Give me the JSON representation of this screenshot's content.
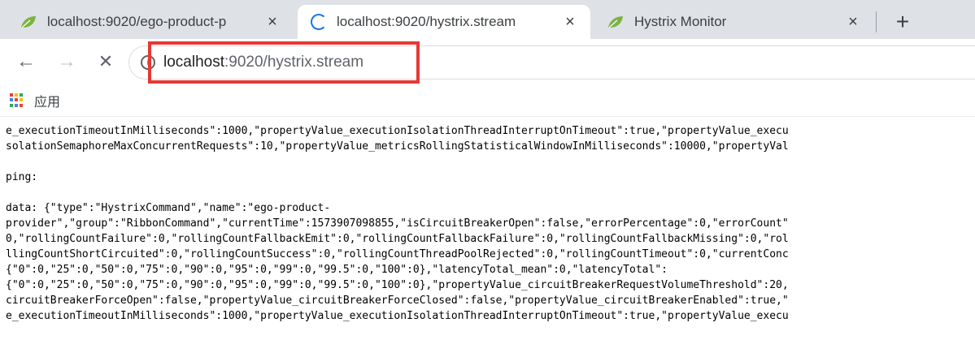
{
  "tabs": [
    {
      "title": "localhost:9020/ego-product-p",
      "close": "×",
      "icon": "leaf-icon",
      "active": false
    },
    {
      "title": "localhost:9020/hystrix.stream",
      "close": "×",
      "icon": "loading-spinner-icon",
      "active": true
    },
    {
      "title": "Hystrix Monitor",
      "close": "×",
      "icon": "leaf-icon",
      "active": false
    }
  ],
  "new_tab_label": "+",
  "toolbar": {
    "back": "←",
    "forward": "→",
    "stop": "✕",
    "url_host": "localhost",
    "url_rest": ":9020/hystrix.stream"
  },
  "bookmarks": {
    "apps_label": "应用"
  },
  "colors": {
    "tab_strip": "#dee1e6",
    "highlight": "#e53935",
    "leaf": "#7cb342"
  },
  "content": {
    "lines_a": [
      "e_executionTimeoutInMilliseconds\":1000,\"propertyValue_executionIsolationThreadInterruptOnTimeout\":true,\"propertyValue_execu",
      "solationSemaphoreMaxConcurrentRequests\":10,\"propertyValue_metricsRollingStatisticalWindowInMilliseconds\":10000,\"propertyVal"
    ],
    "ping": "ping:",
    "lines_b": [
      "data: {\"type\":\"HystrixCommand\",\"name\":\"ego-product-",
      "provider\",\"group\":\"RibbonCommand\",\"currentTime\":1573907098855,\"isCircuitBreakerOpen\":false,\"errorPercentage\":0,\"errorCount\"",
      "0,\"rollingCountFailure\":0,\"rollingCountFallbackEmit\":0,\"rollingCountFallbackFailure\":0,\"rollingCountFallbackMissing\":0,\"rol",
      "llingCountShortCircuited\":0,\"rollingCountSuccess\":0,\"rollingCountThreadPoolRejected\":0,\"rollingCountTimeout\":0,\"currentConc",
      "{\"0\":0,\"25\":0,\"50\":0,\"75\":0,\"90\":0,\"95\":0,\"99\":0,\"99.5\":0,\"100\":0},\"latencyTotal_mean\":0,\"latencyTotal\":",
      "{\"0\":0,\"25\":0,\"50\":0,\"75\":0,\"90\":0,\"95\":0,\"99\":0,\"99.5\":0,\"100\":0},\"propertyValue_circuitBreakerRequestVolumeThreshold\":20,",
      "circuitBreakerForceOpen\":false,\"propertyValue_circuitBreakerForceClosed\":false,\"propertyValue_circuitBreakerEnabled\":true,\"",
      "e_executionTimeoutInMilliseconds\":1000,\"propertyValue_executionIsolationThreadInterruptOnTimeout\":true,\"propertyValue_execu"
    ]
  }
}
